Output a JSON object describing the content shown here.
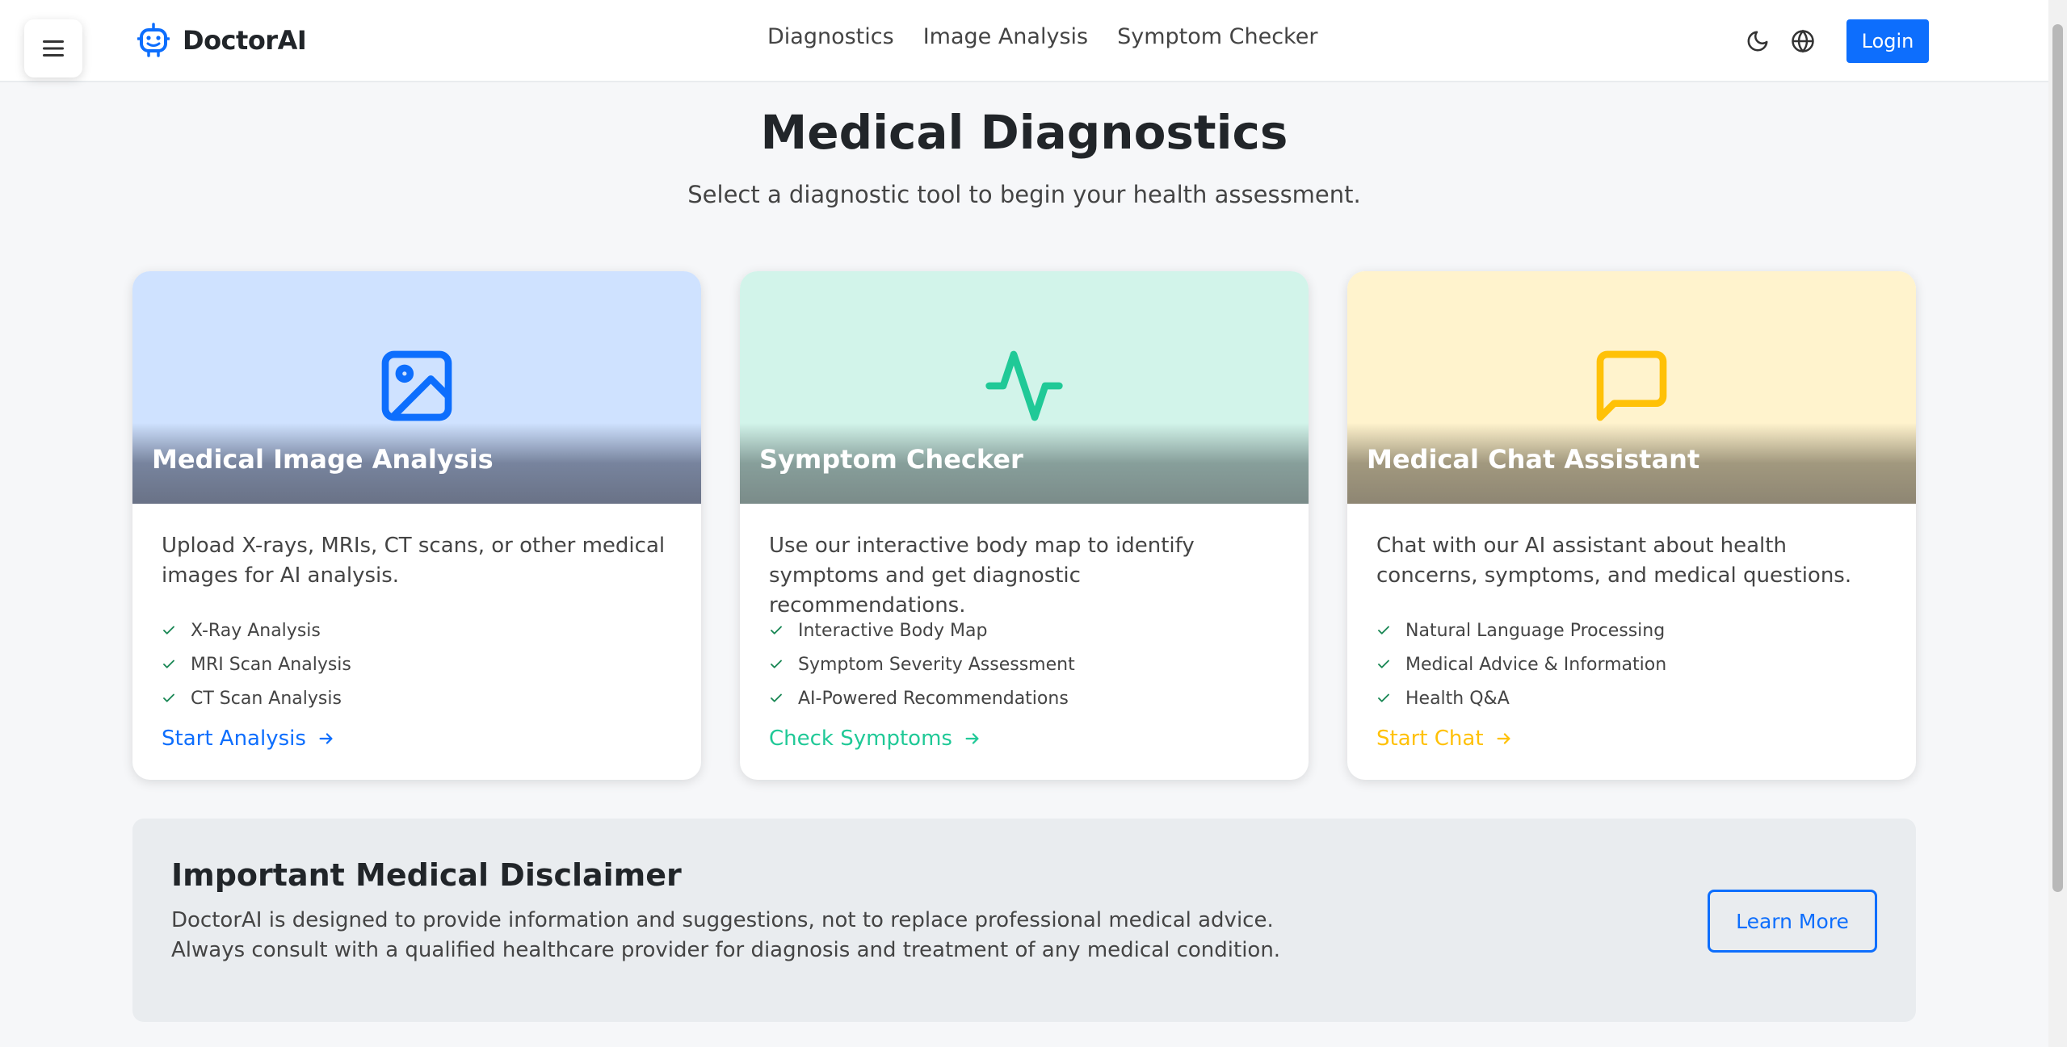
{
  "header": {
    "brand": "DoctorAI",
    "nav": [
      "Diagnostics",
      "Image Analysis",
      "Symptom Checker"
    ],
    "login_label": "Login",
    "icons": [
      "menu-icon",
      "robot-logo-icon",
      "moon-icon",
      "globe-icon"
    ]
  },
  "hero": {
    "title": "Medical Diagnostics",
    "subtitle": "Select a diagnostic tool to begin your health assessment."
  },
  "cards": [
    {
      "title": "Medical Image Analysis",
      "description": "Upload X-rays, MRIs, CT scans, or other medical images for AI analysis.",
      "features": [
        "X-Ray Analysis",
        "MRI Scan Analysis",
        "CT Scan Analysis"
      ],
      "link": "Start Analysis",
      "icon": "image-icon",
      "accent": "#0d6efd",
      "bg": "#cfe2ff"
    },
    {
      "title": "Symptom Checker",
      "description": "Use our interactive body map to identify symptoms and get diagnostic recommendations.",
      "features": [
        "Interactive Body Map",
        "Symptom Severity Assessment",
        "AI-Powered Recommendations"
      ],
      "link": "Check Symptoms",
      "icon": "activity-pulse-icon",
      "accent": "#20c997",
      "bg": "#d2f4ea"
    },
    {
      "title": "Medical Chat Assistant",
      "description": "Chat with our AI assistant about health concerns, symptoms, and medical questions.",
      "features": [
        "Natural Language Processing",
        "Medical Advice & Information",
        "Health Q&A"
      ],
      "link": "Start Chat",
      "icon": "chat-bubble-icon",
      "accent": "#ffc107",
      "bg": "#fff3cd"
    }
  ],
  "disclaimer": {
    "title": "Important Medical Disclaimer",
    "text": "DoctorAI is designed to provide information and suggestions, not to replace professional medical advice. Always consult with a qualified healthcare provider for diagnosis and treatment of any medical condition.",
    "button": "Learn More"
  },
  "colors": {
    "primary": "#0d6efd",
    "success": "#20c997",
    "warning": "#ffc107"
  }
}
